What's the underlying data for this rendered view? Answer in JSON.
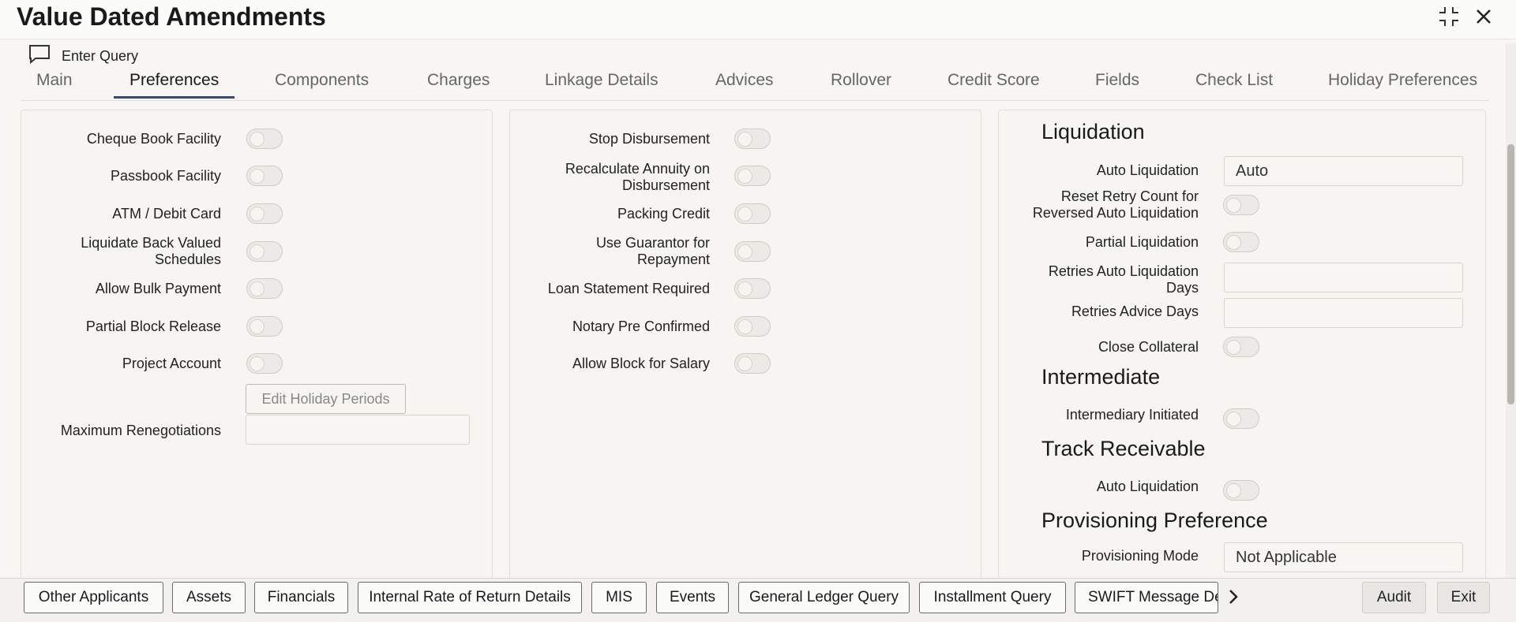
{
  "window": {
    "title": "Value Dated Amendments"
  },
  "query": {
    "label": "Enter Query"
  },
  "tabs": [
    "Main",
    "Preferences",
    "Components",
    "Charges",
    "Linkage Details",
    "Advices",
    "Rollover",
    "Credit Score",
    "Fields",
    "Check List",
    "Holiday Preferences"
  ],
  "active_tab": "Preferences",
  "panel1": {
    "cheque_book": "Cheque Book Facility",
    "passbook": "Passbook Facility",
    "atm": "ATM / Debit Card",
    "liquidate_back_1": "Liquidate Back Valued",
    "liquidate_back_2": "Schedules",
    "bulk_payment": "Allow Bulk Payment",
    "partial_block": "Partial Block Release",
    "project_account": "Project Account",
    "edit_holiday": "Edit Holiday Periods",
    "max_reneg": "Maximum Renegotiations",
    "max_reneg_value": ""
  },
  "panel2": {
    "stop_disb": "Stop Disbursement",
    "recalc_1": "Recalculate Annuity on",
    "recalc_2": "Disbursement",
    "packing_credit": "Packing Credit",
    "guarantor_1": "Use Guarantor for",
    "guarantor_2": "Repayment",
    "loan_statement": "Loan Statement Required",
    "notary": "Notary Pre Confirmed",
    "block_salary": "Allow Block for Salary"
  },
  "panel3": {
    "liquidation_h": "Liquidation",
    "auto_liq": "Auto Liquidation",
    "auto_liq_value": "Auto",
    "reset_retry_1": "Reset Retry Count for",
    "reset_retry_2": "Reversed Auto Liquidation",
    "partial_liq": "Partial Liquidation",
    "retries_days_1": "Retries Auto Liquidation",
    "retries_days_2": "Days",
    "retries_days_value": "",
    "retries_advice": "Retries Advice Days",
    "retries_advice_value": "",
    "close_collateral": "Close Collateral",
    "intermediate_h": "Intermediate",
    "intermediary": "Intermediary Initiated",
    "track_h": "Track Receivable",
    "track_auto_liq": "Auto Liquidation",
    "prov_h": "Provisioning Preference",
    "prov_mode": "Provisioning Mode",
    "prov_mode_value": "Not Applicable"
  },
  "footer": {
    "buttons": [
      "Other Applicants",
      "Assets",
      "Financials",
      "Internal Rate of Return Details",
      "MIS",
      "Events",
      "General Ledger Query",
      "Installment Query",
      "SWIFT Message Det"
    ],
    "audit": "Audit",
    "exit": "Exit"
  },
  "icons": {
    "minimize": "collapse-icon",
    "close": "close-icon",
    "query": "chat-icon",
    "next": "chevron-right-icon"
  }
}
